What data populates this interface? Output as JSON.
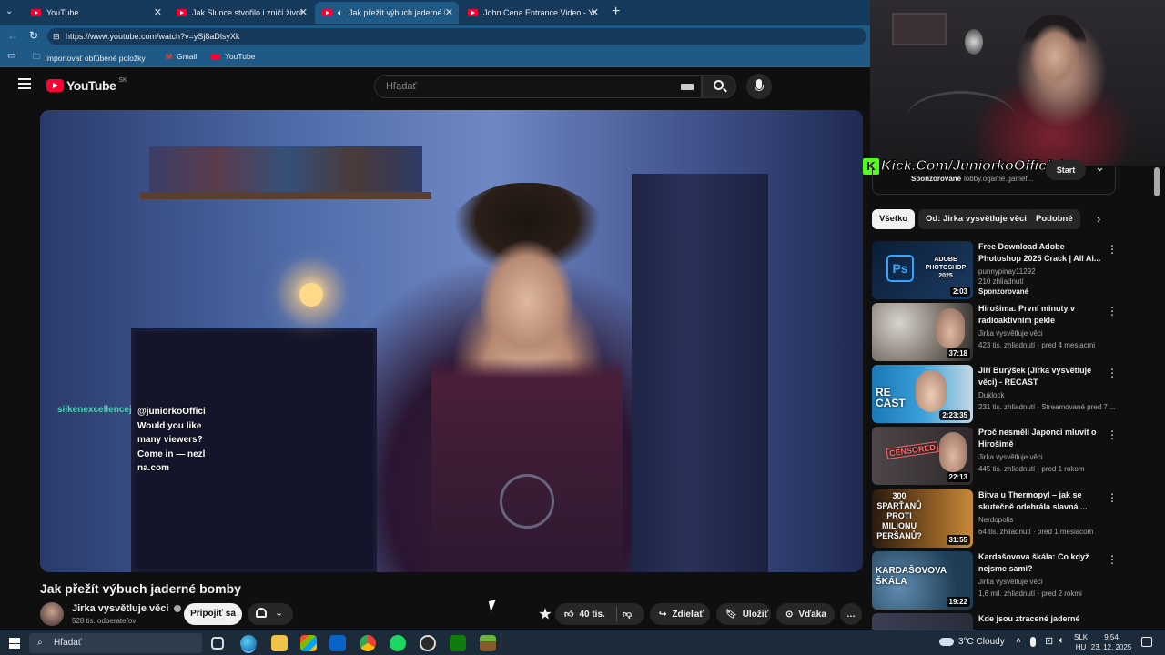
{
  "browser": {
    "tabs": [
      {
        "label": "YouTube"
      },
      {
        "label": "Jak Slunce stvořilo i zničí život na Zem"
      },
      {
        "label": "Jak přežít výbuch jaderné bomby"
      },
      {
        "label": "John Cena Entrance Video - YouTube"
      }
    ],
    "new_tab": "+",
    "url": "https://www.youtube.com/watch?v=ySj8aDlsyXk",
    "bookmarks": [
      "Importovať obľúbené položky",
      "Gmail",
      "YouTube"
    ]
  },
  "youtube": {
    "logo_text": "YouTube",
    "region": "SK",
    "search_placeholder": "Hľadať"
  },
  "video": {
    "title": "Jak přežít výbuch jaderné bomby",
    "channel": "Jirka vysvětluje věci",
    "subscribers": "528 tis. odberateľov",
    "join_label": "Pripojiť sa",
    "likes": "40 tis.",
    "share_label": "Zdieľať",
    "save_label": "Uložiť",
    "thanks_label": "Vďaka",
    "more": "…"
  },
  "chat": {
    "user": "silkenexcellencej",
    "lines": [
      "@juniorkoOffici",
      "Would you like",
      "many viewers?",
      "Come in — nezl",
      "na.com"
    ]
  },
  "stream_overlay": {
    "kick_text": "Kick.Com/JuniorkoOfficial"
  },
  "sidebar": {
    "sponsor": {
      "label": "Sponzorované",
      "site": "lobby.ogame.gamef...",
      "start": "Start"
    },
    "chips": [
      "Všetko",
      "Od: Jirka vysvětluje věci",
      "Podobné"
    ],
    "recommendations": [
      {
        "title": "Free Download Adobe Photoshop 2025 Crack | All Ai...",
        "channel": "punnypinay11292",
        "meta": "210 zhliadnutí",
        "badge": "Sponzorované",
        "duration": "2:03",
        "thumb_text": "ADOBE PHOTOSHOP 2025",
        "thumb_color": "#0f2b4a"
      },
      {
        "title": "Hirošima: První minuty v radioaktivním pekle",
        "channel": "Jirka vysvětluje věci",
        "meta": "423 tis. zhliadnutí · pred 4 mesiacmi",
        "badge": "",
        "duration": "37:18",
        "thumb_text": "",
        "thumb_color": "#5b5550"
      },
      {
        "title": "Jiří Burýšek (Jirka vysvětluje věci) - RECAST",
        "channel": "Duklock",
        "meta": "231 tis. zhliadnutí · Streamované pred 7 ...",
        "badge": "",
        "duration": "2:23:35",
        "thumb_text": "RE CAST",
        "thumb_color": "#1a79b8"
      },
      {
        "title": "Proč nesměli Japonci mluvit o Hirošimě",
        "channel": "Jirka vysvětluje věci",
        "meta": "445 tis. zhliadnutí · pred 1 rokom",
        "badge": "",
        "duration": "22:13",
        "thumb_text": "CENSORED",
        "thumb_color": "#3a3234"
      },
      {
        "title": "Bitva u Thermopyl – jak se skutečně odehrála slavná ...",
        "channel": "Nerdopolis",
        "meta": "64 tis. zhliadnutí · pred 1 mesiacom",
        "badge": "",
        "duration": "31:55",
        "thumb_text": "300 SPARŤANŮ PROTI MILIONU PERŠANŮ?",
        "thumb_color": "#6b4a22"
      },
      {
        "title": "Kardašovova škála: Co když nejsme sami?",
        "channel": "Jirka vysvětluje věci",
        "meta": "1,6 mil. zhliadnutí · pred 2 rokmi",
        "badge": "",
        "duration": "19:22",
        "thumb_text": "KARDAŠOVOVA ŠKÁLA",
        "thumb_color": "#2b5e7a"
      },
      {
        "title": "Kde jsou ztracené jaderné",
        "channel": "",
        "meta": "",
        "badge": "",
        "duration": "",
        "thumb_text": "",
        "thumb_color": "#3b3f52"
      }
    ]
  },
  "taskbar": {
    "search_placeholder": "Hľadať",
    "weather": "3°C  Cloudy",
    "lang_line1": "SLK",
    "lang_line2": "HU",
    "time": "9:54",
    "date": "23. 12. 2025"
  }
}
